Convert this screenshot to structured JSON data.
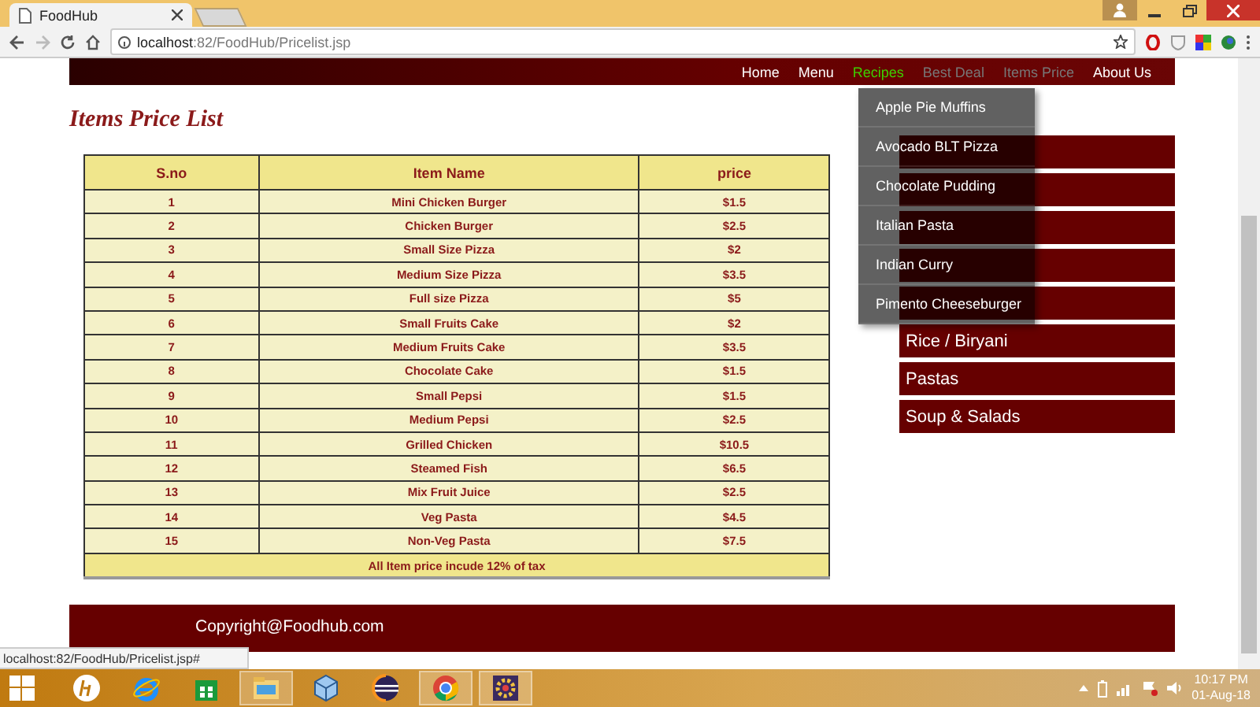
{
  "browser": {
    "tab_title": "FoodHub",
    "url_host": "localhost",
    "url_rest": ":82/FoodHub/Pricelist.jsp",
    "status_url": "localhost:82/FoodHub/Pricelist.jsp#"
  },
  "nav": [
    {
      "label": "Home",
      "selected": false,
      "disabled": false
    },
    {
      "label": "Menu",
      "selected": false,
      "disabled": false
    },
    {
      "label": "Recipes",
      "selected": true,
      "disabled": false
    },
    {
      "label": "Best Deal",
      "selected": false,
      "disabled": true
    },
    {
      "label": "Items Price",
      "selected": false,
      "disabled": true
    },
    {
      "label": "About Us",
      "selected": false,
      "disabled": false
    }
  ],
  "recipes_dropdown": [
    "Apple Pie Muffins",
    "Avocado BLT Pizza",
    "Chocolate Pudding",
    "Italian Pasta",
    "Indian Curry",
    "Pimento Cheeseburger"
  ],
  "page_title": "Items Price List",
  "table": {
    "columns": [
      "S.no",
      "Item Name",
      "price"
    ],
    "rows": [
      [
        "1",
        "Mini Chicken Burger",
        "$1.5"
      ],
      [
        "2",
        "Chicken Burger",
        "$2.5"
      ],
      [
        "3",
        "Small Size Pizza",
        "$2"
      ],
      [
        "4",
        "Medium Size Pizza",
        "$3.5"
      ],
      [
        "5",
        "Full size Pizza",
        "$5"
      ],
      [
        "6",
        "Small Fruits Cake",
        "$2"
      ],
      [
        "7",
        "Medium Fruits Cake",
        "$3.5"
      ],
      [
        "8",
        "Chocolate Cake",
        "$1.5"
      ],
      [
        "9",
        "Small Pepsi",
        "$1.5"
      ],
      [
        "10",
        "Medium Pepsi",
        "$2.5"
      ],
      [
        "11",
        "Grilled Chicken",
        "$10.5"
      ],
      [
        "12",
        "Steamed Fish",
        "$6.5"
      ],
      [
        "13",
        "Mix Fruit Juice",
        "$2.5"
      ],
      [
        "14",
        "Veg Pasta",
        "$4.5"
      ],
      [
        "15",
        "Non-Veg Pasta",
        "$7.5"
      ]
    ],
    "footnote": "All Item price incude 12% of tax"
  },
  "quick_menu": {
    "items": [
      {
        "kind": "covered"
      },
      {
        "kind": "covered"
      },
      {
        "kind": "covered"
      },
      {
        "kind": "covered"
      },
      {
        "kind": "covered"
      },
      {
        "kind": "link",
        "label": "Rice / Biryani"
      },
      {
        "kind": "link",
        "label": "Pastas"
      },
      {
        "kind": "link",
        "label": "Soup & Salads"
      }
    ]
  },
  "footer": {
    "copyright": "Copyright@Foodhub.com"
  },
  "taskbar": {
    "apps": [
      {
        "kind": "hp",
        "running": false
      },
      {
        "kind": "ie",
        "running": false
      },
      {
        "kind": "store",
        "running": false
      },
      {
        "kind": "explorer",
        "running": true
      },
      {
        "kind": "cube",
        "running": false
      },
      {
        "kind": "eclipse",
        "running": false
      },
      {
        "kind": "chrome",
        "running": true
      },
      {
        "kind": "app",
        "running": true
      }
    ],
    "time": "10:17 PM",
    "date": "01-Aug-18"
  }
}
